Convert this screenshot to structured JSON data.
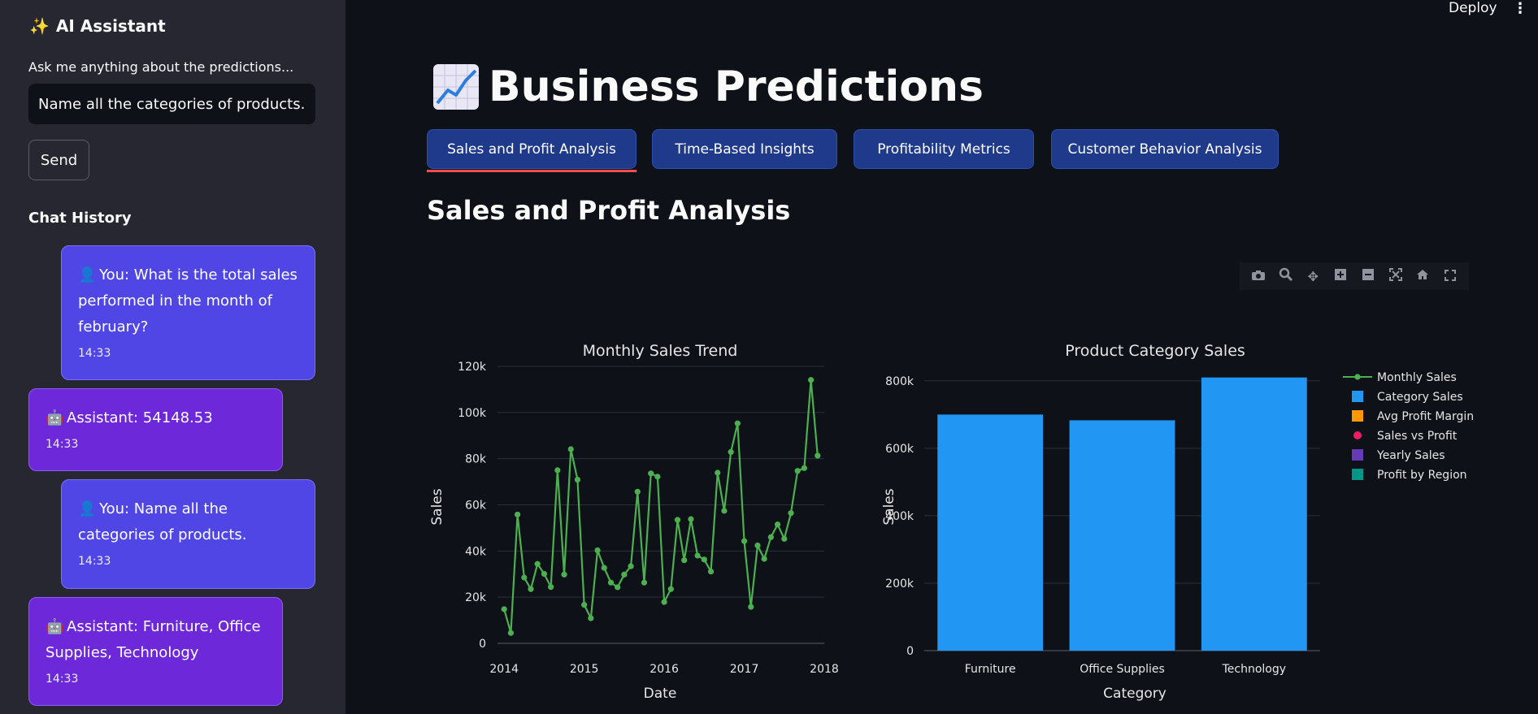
{
  "sidebar": {
    "title": "AI Assistant",
    "prompt": "Ask me anything about the predictions...",
    "input_value": "Name all the categories of products.",
    "send_label": "Send",
    "history_title": "Chat History",
    "messages": [
      {
        "role": "user",
        "text": "You: What is the total sales performed in the month of february?",
        "time": "14:33"
      },
      {
        "role": "assistant",
        "text": "Assistant: 54148.53",
        "time": "14:33"
      },
      {
        "role": "user",
        "text": "You: Name all the categories of products.",
        "time": "14:33"
      },
      {
        "role": "assistant",
        "text": "Assistant: Furniture, Office Supplies, Technology",
        "time": "14:33"
      }
    ]
  },
  "header": {
    "deploy_label": "Deploy",
    "menu_icon": "kebab-menu-icon"
  },
  "page": {
    "title": "Business Predictions",
    "title_icon": "chart-increasing-icon",
    "tabs": [
      "Sales and Profit Analysis",
      "Time-Based Insights",
      "Profitability Metrics",
      "Customer Behavior Analysis"
    ],
    "active_tab": 0,
    "section_title": "Sales and Profit Analysis"
  },
  "toolbar_icons": [
    "camera-icon",
    "zoom-icon",
    "pan-icon",
    "zoom-in-icon",
    "zoom-out-icon",
    "autoscale-icon",
    "reset-axes-icon",
    "fullscreen-icon"
  ],
  "colors": {
    "line": "#4caf50",
    "bar": "#2196f3",
    "legend": [
      "#4caf50",
      "#2196f3",
      "#ff9800",
      "#e91e63",
      "#673ab7",
      "#009688"
    ]
  },
  "legend": [
    "Monthly Sales",
    "Category Sales",
    "Avg Profit Margin",
    "Sales vs Profit",
    "Yearly Sales",
    "Profit by Region"
  ],
  "chart_data": [
    {
      "type": "line",
      "title": "Monthly Sales Trend",
      "xlabel": "Date",
      "ylabel": "Sales",
      "x_ticks": [
        "2014",
        "2015",
        "2016",
        "2017",
        "2018"
      ],
      "y_ticks": [
        "0",
        "20k",
        "40k",
        "60k",
        "80k",
        "100k",
        "120k"
      ],
      "ylim": [
        0,
        120000
      ],
      "xlim": [
        "2013-12",
        "2018-01"
      ],
      "series": [
        {
          "name": "Monthly Sales",
          "x": [
            "2014-01",
            "2014-02",
            "2014-03",
            "2014-04",
            "2014-05",
            "2014-06",
            "2014-07",
            "2014-08",
            "2014-09",
            "2014-10",
            "2014-11",
            "2014-12",
            "2015-01",
            "2015-02",
            "2015-03",
            "2015-04",
            "2015-05",
            "2015-06",
            "2015-07",
            "2015-08",
            "2015-09",
            "2015-10",
            "2015-11",
            "2015-12",
            "2016-01",
            "2016-02",
            "2016-03",
            "2016-04",
            "2016-05",
            "2016-06",
            "2016-07",
            "2016-08",
            "2016-09",
            "2016-10",
            "2016-11",
            "2016-12",
            "2017-01",
            "2017-02",
            "2017-03",
            "2017-04",
            "2017-05",
            "2017-06",
            "2017-07",
            "2017-08",
            "2017-09",
            "2017-10",
            "2017-11",
            "2017-12"
          ],
          "y": [
            14800,
            4500,
            55800,
            28500,
            23500,
            34400,
            30100,
            24400,
            75000,
            29800,
            84100,
            70900,
            16700,
            10900,
            40300,
            32700,
            26300,
            24300,
            29800,
            33400,
            65700,
            26300,
            73600,
            72200,
            17900,
            23500,
            53500,
            36000,
            53800,
            38000,
            36300,
            31100,
            73900,
            57400,
            82900,
            95300,
            44300,
            15800,
            42400,
            36600,
            46000,
            51500,
            45300,
            56400,
            74700,
            75900,
            114100,
            81300
          ]
        }
      ]
    },
    {
      "type": "bar",
      "title": "Product Category Sales",
      "xlabel": "Category",
      "ylabel": "Sales",
      "categories": [
        "Furniture",
        "Office Supplies",
        "Technology"
      ],
      "values": [
        700000,
        683000,
        810000
      ],
      "y_ticks": [
        "0",
        "200k",
        "400k",
        "600k",
        "800k"
      ],
      "ylim": [
        0,
        843000
      ]
    }
  ]
}
